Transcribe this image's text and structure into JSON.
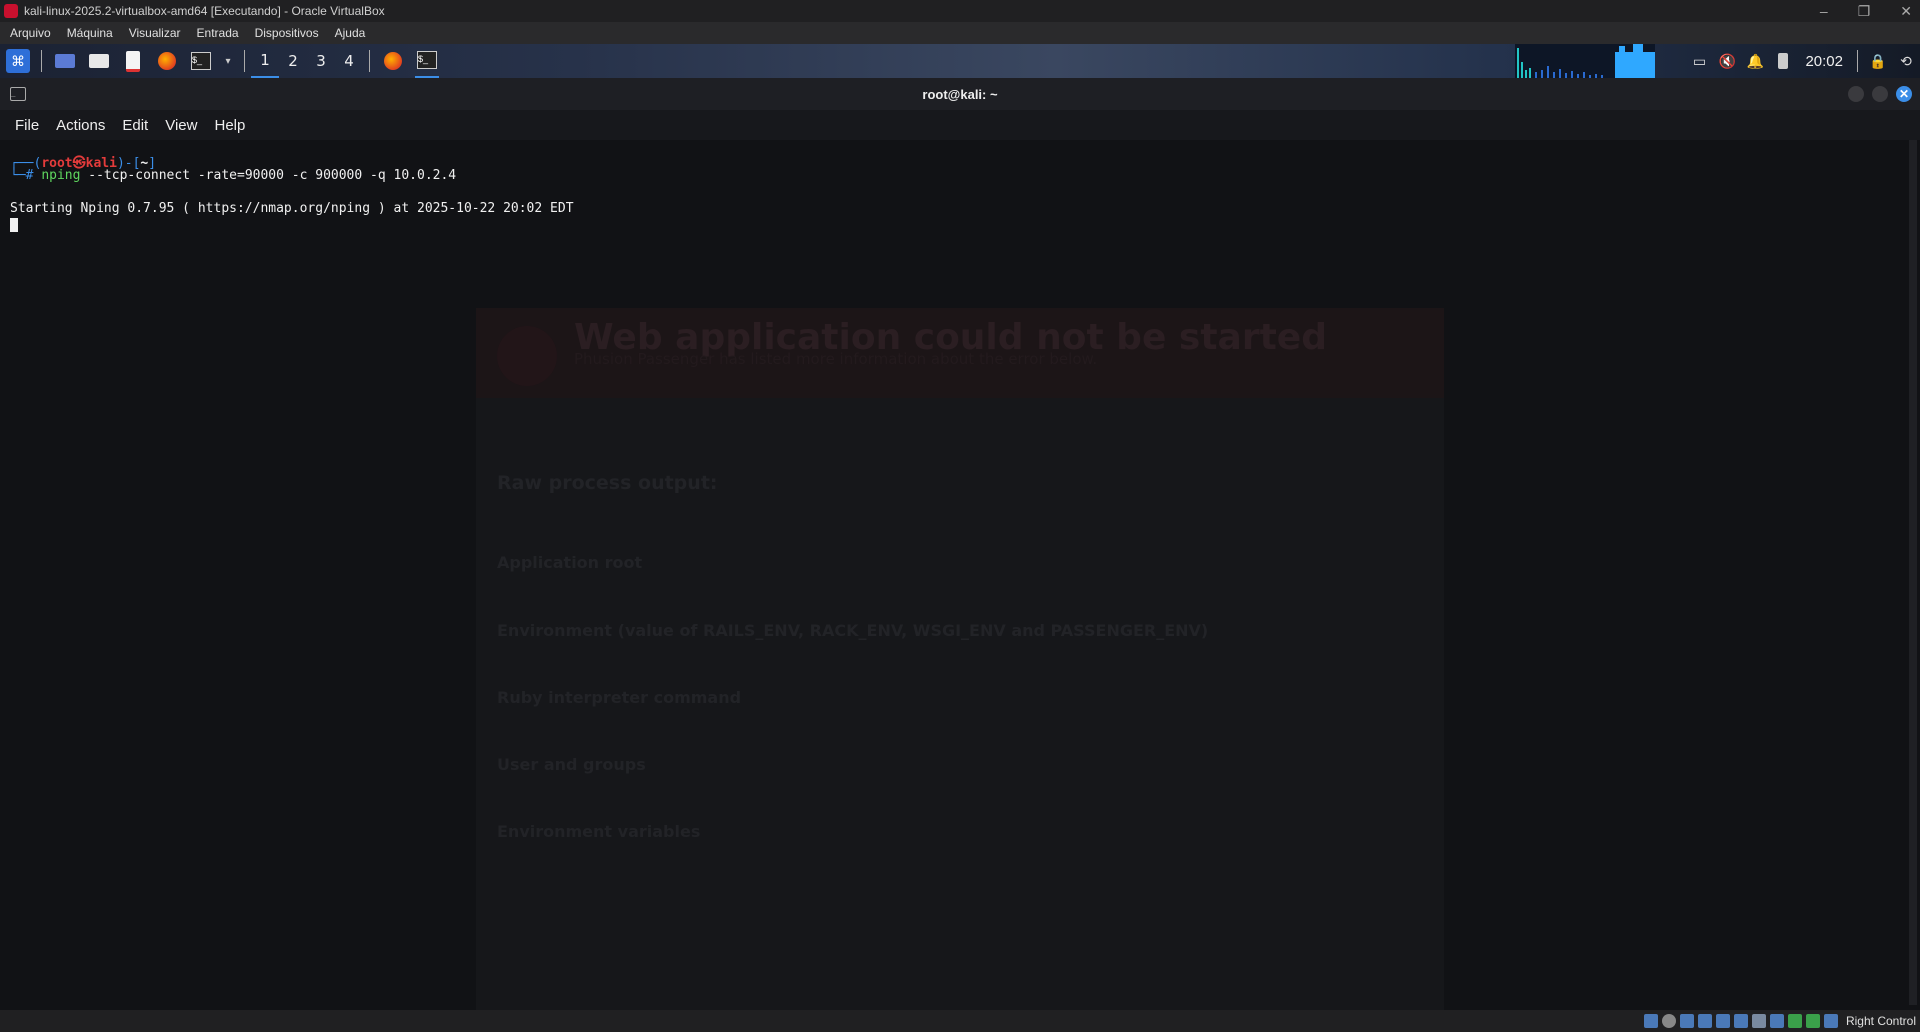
{
  "vbox": {
    "window_title": "kali-linux-2025.2-virtualbox-amd64 [Executando] - Oracle VirtualBox",
    "menu": [
      "Arquivo",
      "Máquina",
      "Visualizar",
      "Entrada",
      "Dispositivos",
      "Ajuda"
    ],
    "host_key": "Right Control"
  },
  "panel": {
    "workspaces": [
      "1",
      "2",
      "3",
      "4"
    ],
    "active_workspace": "1",
    "clock": "20:02"
  },
  "terminal": {
    "title": "root@kali: ~",
    "menu": [
      "File",
      "Actions",
      "Edit",
      "View",
      "Help"
    ],
    "prompt_open": "┌──(",
    "prompt_user": "root㉿kali",
    "prompt_close": ")-[",
    "prompt_dir": "~",
    "prompt_end": "]",
    "prompt_hash": "└─#",
    "cmd_name": "nping",
    "cmd_args": "--tcp-connect -rate=90000 -c 900000 -q 10.0.2.4",
    "output_line": "Starting Nping 0.7.95 ( https://nmap.org/nping ) at 2025-10-22 20:02 EDT"
  },
  "background_page": {
    "title": "Web application could not be started",
    "subtitle": "Phusion Passenger has listed more information about the error below.",
    "headings": [
      "Raw process output:",
      "Application root",
      "Environment (value of RAILS_ENV, RACK_ENV, WSGI_ENV and PASSENGER_ENV)",
      "Ruby interpreter command",
      "User and groups",
      "Environment variables"
    ]
  },
  "colors": {
    "prompt_red": "#e33b3b",
    "prompt_blue": "#3b8ee8",
    "terminal_bg": "#111215"
  }
}
